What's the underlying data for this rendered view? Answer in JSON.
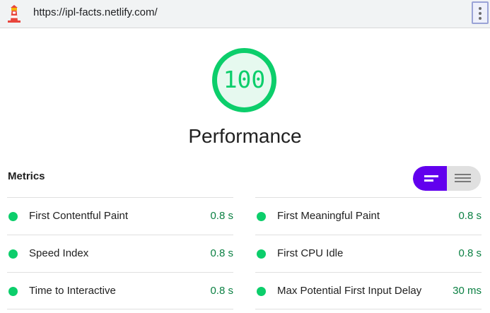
{
  "address_bar": {
    "url": "https://ipl-facts.netlify.com/",
    "logo_icon": "lighthouse-icon",
    "menu_icon": "kebab-menu-icon"
  },
  "score": {
    "value": "100",
    "fraction": 1.0,
    "title": "Performance",
    "color": "#0cce6b"
  },
  "metrics": {
    "title": "Metrics",
    "toggle": {
      "active": "compact-view-icon",
      "inactive": "expanded-view-icon",
      "accent": "#6200ee"
    },
    "left": [
      {
        "label": "First Contentful Paint",
        "value": "0.8 s",
        "status": "pass"
      },
      {
        "label": "Speed Index",
        "value": "0.8 s",
        "status": "pass"
      },
      {
        "label": "Time to Interactive",
        "value": "0.8 s",
        "status": "pass"
      }
    ],
    "right": [
      {
        "label": "First Meaningful Paint",
        "value": "0.8 s",
        "status": "pass"
      },
      {
        "label": "First CPU Idle",
        "value": "0.8 s",
        "status": "pass"
      },
      {
        "label": "Max Potential First Input Delay",
        "value": "30 ms",
        "status": "pass"
      }
    ]
  }
}
